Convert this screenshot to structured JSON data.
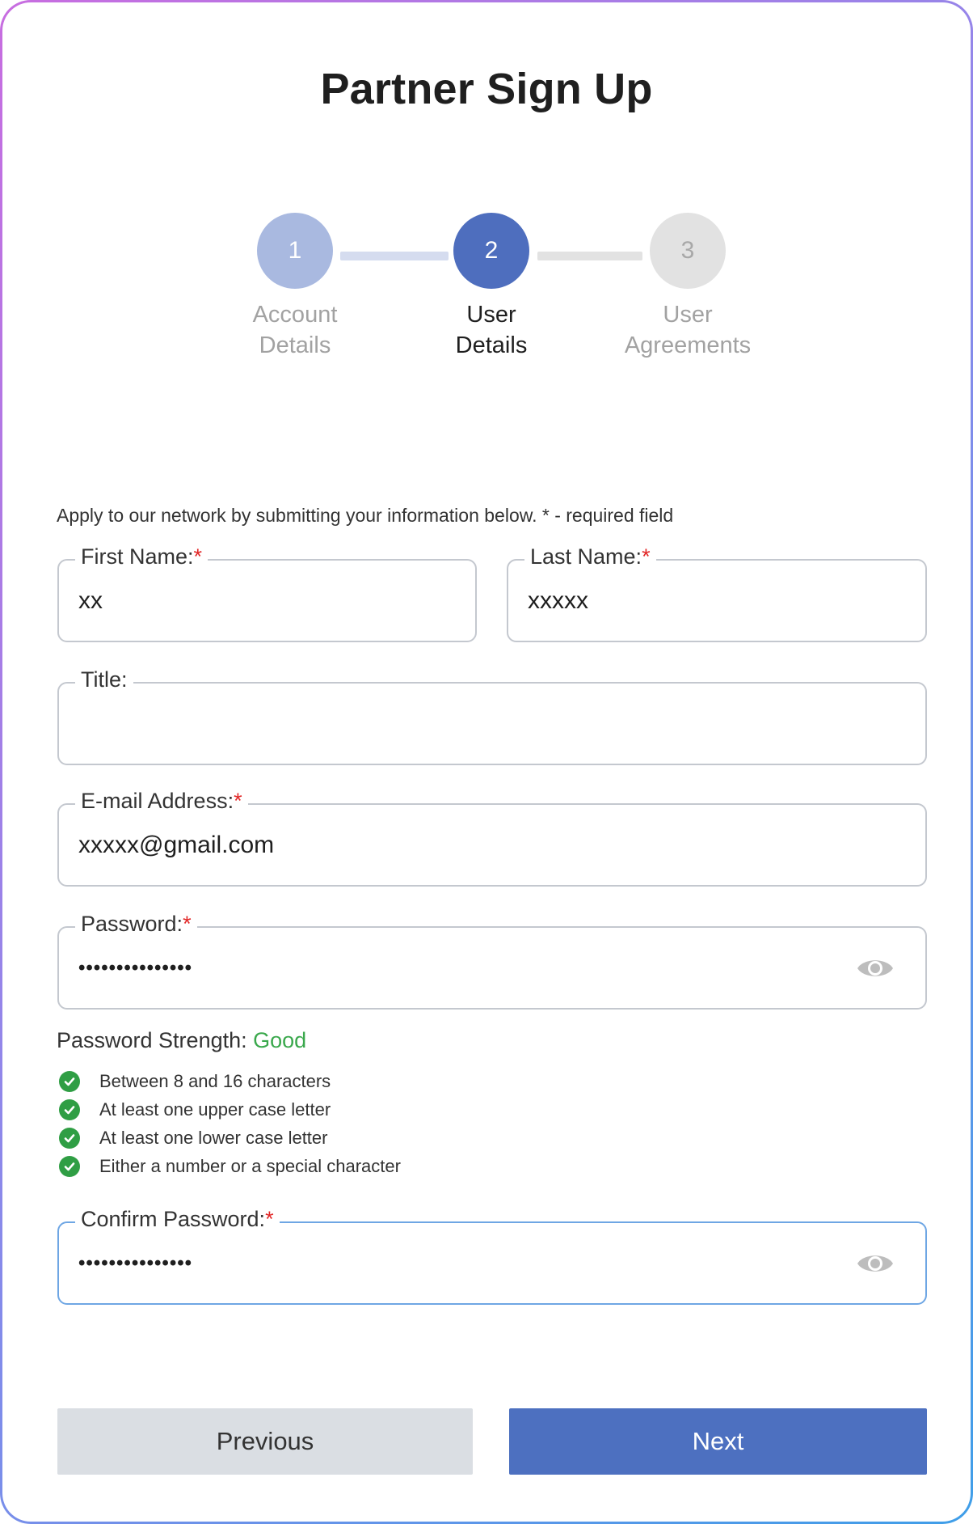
{
  "page": {
    "title": "Partner Sign Up"
  },
  "stepper": {
    "steps": [
      {
        "number": "1",
        "label_line1": "Account",
        "label_line2": "Details",
        "state": "completed"
      },
      {
        "number": "2",
        "label_line1": "User",
        "label_line2": "Details",
        "state": "active"
      },
      {
        "number": "3",
        "label_line1": "User",
        "label_line2": "Agreements",
        "state": "upcoming"
      }
    ]
  },
  "form": {
    "intro": "Apply to our network by submitting your information below. * - required field",
    "required_marker": "*",
    "first_name": {
      "label": "First Name:",
      "value": "xx"
    },
    "last_name": {
      "label": "Last Name:",
      "value": "xxxxx"
    },
    "title": {
      "label": "Title:",
      "value": ""
    },
    "email": {
      "label": "E-mail Address:",
      "value": "xxxxx@gmail.com"
    },
    "password": {
      "label": "Password:",
      "value": "•••••••••••••••"
    },
    "confirm_password": {
      "label": "Confirm Password:",
      "value": "•••••••••••••••"
    }
  },
  "password_strength": {
    "label": "Password Strength:",
    "value": "Good",
    "rules": [
      "Between 8 and 16 characters",
      "At least one upper case letter",
      "At least one lower case letter",
      "Either a number or a special character"
    ]
  },
  "buttons": {
    "previous": "Previous",
    "next": "Next"
  },
  "colors": {
    "primary": "#4d70c0",
    "step_completed": "#a9b9e0",
    "step_upcoming": "#e2e2e2",
    "required": "#e22727",
    "success": "#3aa84c",
    "focus_border": "#6ea6e4"
  },
  "icons": {
    "password_toggle": "eye-icon",
    "rule_status": "check-circle-icon"
  }
}
